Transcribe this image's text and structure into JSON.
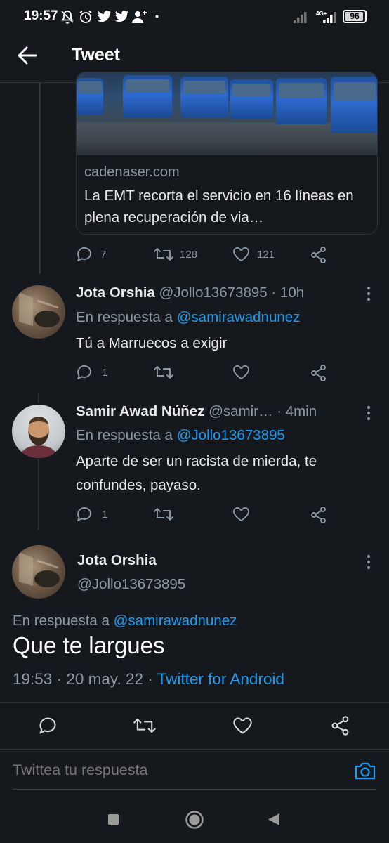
{
  "status_bar": {
    "time": "19:57",
    "network": "4G+",
    "battery": "96",
    "icons": [
      "mute-bell-icon",
      "alarm-icon",
      "twitter-bird-icon",
      "twitter-bird-icon",
      "add-user-icon",
      "dot-icon",
      "signal-icon",
      "signal-icon"
    ]
  },
  "header": {
    "title": "Tweet",
    "back_icon": "arrow-left-icon"
  },
  "link_card": {
    "domain": "cadenaser.com",
    "title": "La EMT recorta el servicio en 16 líneas en plena recuperación de via…"
  },
  "card_actions": {
    "replies": "7",
    "retweets": "128",
    "likes": "121"
  },
  "tweets": [
    {
      "name": "Jota Orshia",
      "handle": "@Jollo13673895",
      "time": "· 10h",
      "reply_prefix": "En respuesta a",
      "reply_to": "@samirawadnunez",
      "text": "Tú a Marruecos a exigir",
      "replies": "1"
    },
    {
      "name": "Samir Awad Núñez",
      "handle": "@samir…",
      "time": "· 4min",
      "reply_prefix": "En respuesta a",
      "reply_to": "@Jollo13673895",
      "text": "Aparte de ser un racista de mierda, te confundes, payaso.",
      "replies": "1"
    }
  ],
  "main_tweet": {
    "name": "Jota Orshia",
    "handle": "@Jollo13673895",
    "reply_prefix": "En respuesta a",
    "reply_to": "@samirawadnunez",
    "text": "Que te largues",
    "time": "19:53",
    "date": "20 may. 22",
    "source": "Twitter for Android"
  },
  "reply_box": {
    "placeholder": "Twittea tu respuesta"
  },
  "colors": {
    "background": "#15181c",
    "accent": "#1d9bf0",
    "muted": "#8b98a5",
    "text": "#e7e9ea"
  }
}
